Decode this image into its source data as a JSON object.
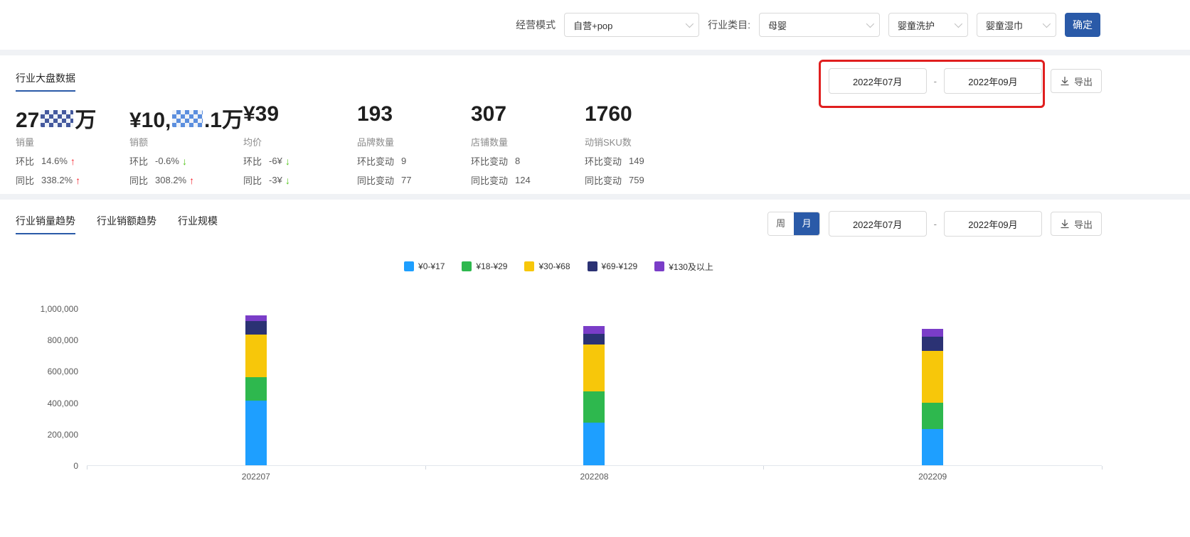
{
  "colors": {
    "primary": "#2a5aa8",
    "up": "#f5222d",
    "down": "#52c41a",
    "annotation": "#e01f1f"
  },
  "filter_bar": {
    "business_mode_label": "经营模式",
    "business_mode_value": "自营+pop",
    "category_label": "行业类目:",
    "category_value": "母婴",
    "sub_category_value": "婴童洗护",
    "leaf_category_value": "婴童湿巾",
    "confirm_label": "确定"
  },
  "overview": {
    "title": "行业大盘数据",
    "date_start": "2022年07月",
    "date_separator": "-",
    "date_end": "2022年09月",
    "export_label": "导出",
    "kpis": [
      {
        "parts": [
          {
            "type": "text",
            "text": "27"
          },
          {
            "type": "mosaic",
            "colors": [
              "#44599e",
              "#d9e1ee"
            ],
            "width": 46
          },
          {
            "type": "text",
            "text": "万"
          }
        ],
        "label": "销量",
        "rows": [
          {
            "name": "环比",
            "value": "14.6%",
            "trend": "up"
          },
          {
            "name": "同比",
            "value": "338.2%",
            "trend": "up"
          }
        ]
      },
      {
        "parts": [
          {
            "type": "text",
            "text": "¥10,"
          },
          {
            "type": "mosaic",
            "colors": [
              "#5b8ede",
              "#efb46a"
            ],
            "width": 52
          },
          {
            "type": "text",
            "text": ".1万"
          }
        ],
        "label": "销额",
        "rows": [
          {
            "name": "环比",
            "value": "-0.6%",
            "trend": "down"
          },
          {
            "name": "同比",
            "value": "308.2%",
            "trend": "up"
          }
        ]
      },
      {
        "parts": [
          {
            "type": "text",
            "text": "¥39"
          }
        ],
        "label": "均价",
        "rows": [
          {
            "name": "环比",
            "value": "-6¥",
            "trend": "down"
          },
          {
            "name": "同比",
            "value": "-3¥",
            "trend": "down"
          }
        ]
      },
      {
        "parts": [
          {
            "type": "text",
            "text": "193"
          }
        ],
        "label": "品牌数量",
        "rows": [
          {
            "name": "环比变动",
            "value": "9",
            "trend": "none"
          },
          {
            "name": "同比变动",
            "value": "77",
            "trend": "none"
          }
        ]
      },
      {
        "parts": [
          {
            "type": "text",
            "text": "307"
          }
        ],
        "label": "店铺数量",
        "rows": [
          {
            "name": "环比变动",
            "value": "8",
            "trend": "none"
          },
          {
            "name": "同比变动",
            "value": "124",
            "trend": "none"
          }
        ]
      },
      {
        "parts": [
          {
            "type": "text",
            "text": "1760"
          }
        ],
        "label": "动销SKU数",
        "rows": [
          {
            "name": "环比变动",
            "value": "149",
            "trend": "none"
          },
          {
            "name": "同比变动",
            "value": "759",
            "trend": "none"
          }
        ]
      }
    ]
  },
  "trend": {
    "tabs": [
      {
        "label": "行业销量趋势",
        "active": true
      },
      {
        "label": "行业销额趋势",
        "active": false
      },
      {
        "label": "行业规模",
        "active": false
      }
    ],
    "period_toggle": [
      {
        "label": "周",
        "active": false
      },
      {
        "label": "月",
        "active": true
      }
    ],
    "date_start": "2022年07月",
    "date_separator": "-",
    "date_end": "2022年09月",
    "export_label": "导出"
  },
  "chart_data": {
    "type": "bar",
    "stacked": true,
    "title": "",
    "xlabel": "",
    "ylabel": "",
    "categories": [
      "202207",
      "202208",
      "202209"
    ],
    "series": [
      {
        "name": "¥0-¥17",
        "color": "#1e9fff",
        "values": [
          415000,
          275000,
          230000
        ]
      },
      {
        "name": "¥18-¥29",
        "color": "#2eb84e",
        "values": [
          150000,
          200000,
          170000
        ]
      },
      {
        "name": "¥30-¥68",
        "color": "#f7c70a",
        "values": [
          270000,
          300000,
          330000
        ]
      },
      {
        "name": "¥69-¥129",
        "color": "#2b3274",
        "values": [
          90000,
          65000,
          95000
        ]
      },
      {
        "name": "¥130及以上",
        "color": "#7a3dc8",
        "values": [
          35000,
          50000,
          50000
        ]
      }
    ],
    "ylim": [
      0,
      1000000
    ],
    "yticks": [
      "0",
      "200,000",
      "400,000",
      "600,000",
      "800,000",
      "1,000,000"
    ],
    "legend_position": "top-center",
    "grid": false
  }
}
